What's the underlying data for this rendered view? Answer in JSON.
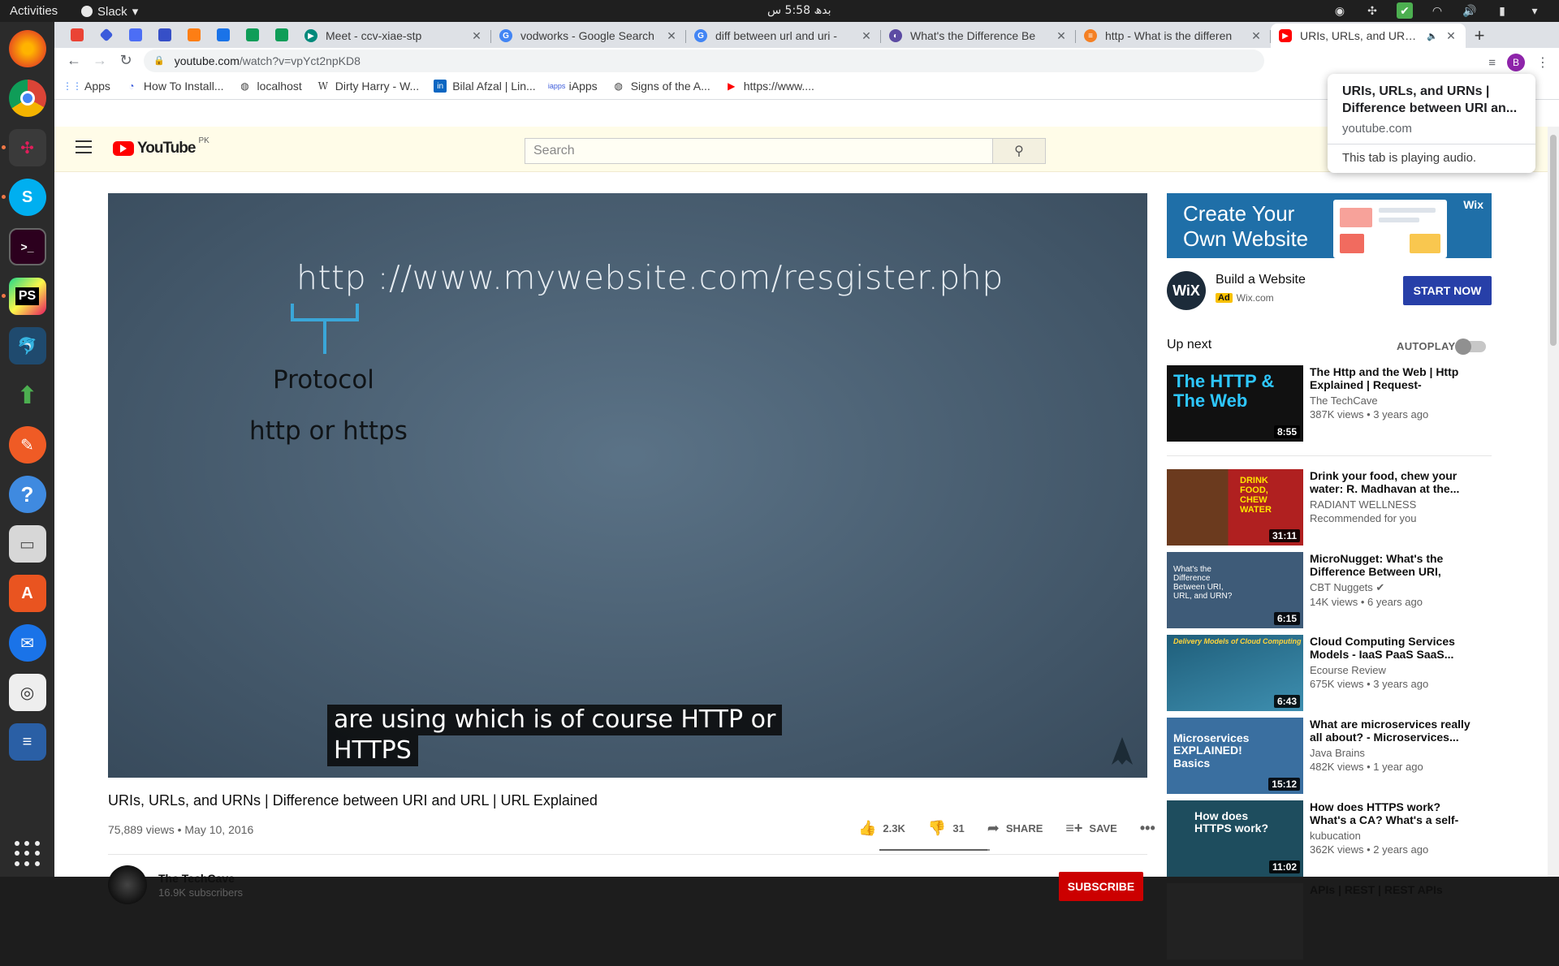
{
  "topbar": {
    "activities": "Activities",
    "app_name": "Slack",
    "clock": "بدھ 5:58 س"
  },
  "tabs": [
    {
      "label": "Meet - ccv-xiae-stp",
      "favicon_color": "#00897b"
    },
    {
      "label": "vodworks - Google Search",
      "favicon_color": "#4285f4"
    },
    {
      "label": "diff between url and uri - ",
      "favicon_color": "#4285f4"
    },
    {
      "label": "What's the Difference Be",
      "favicon_color": "#5c4ba3"
    },
    {
      "label": "http - What is the differen",
      "favicon_color": "#f48024"
    },
    {
      "label": "URIs, URLs, and URNs |",
      "favicon_color": "#ff0000",
      "active": true
    }
  ],
  "omnibox": {
    "host": "youtube.com",
    "path": "/watch?v=vpYct2npKD8"
  },
  "bookmarks": [
    {
      "label": "Apps"
    },
    {
      "label": "How To Install..."
    },
    {
      "label": "localhost"
    },
    {
      "label": "Dirty Harry - W..."
    },
    {
      "label": "Bilal Afzal | Lin..."
    },
    {
      "label": "iApps"
    },
    {
      "label": "Signs of the A..."
    },
    {
      "label": "https://www...."
    }
  ],
  "hovercard": {
    "title": "URIs, URLs, and URNs | Difference between URI an...",
    "url": "youtube.com",
    "note": "This tab is playing audio."
  },
  "youtube": {
    "logo_text": "YouTube",
    "region": "PK",
    "search_placeholder": "Search",
    "avatar_letter": "B"
  },
  "video": {
    "board_url": "http ://www.mywebsite.com/resgister.php",
    "board_protocol": "Protocol",
    "board_protocol_sub": "http or https",
    "caption_line1": "are using which is of course HTTP or",
    "caption_line2": "HTTPS",
    "title": "URIs, URLs, and URNs | Difference between URI and URL | URL Explained",
    "meta": "75,889 views • May 10, 2016",
    "likes": "2.3K",
    "dislikes": "31",
    "share_label": "SHARE",
    "save_label": "SAVE",
    "like_ratio": 0.98
  },
  "channel": {
    "name": "The TechCave",
    "subs": "16.9K subscribers",
    "subscribe_label": "SUBSCRIBE"
  },
  "ad": {
    "banner_line1": "Create Your",
    "banner_line2": "Own Website",
    "banner_brand": "Wix",
    "logo_text": "WiX",
    "title": "Build a Website",
    "badge": "Ad",
    "domain": "Wix.com",
    "cta": "START NOW"
  },
  "upnext": {
    "label": "Up next",
    "autoplay_label": "AUTOPLAY"
  },
  "recs": [
    {
      "title": "The Http and the Web | Http Explained | Request-Response...",
      "channel": "The TechCave",
      "meta": "387K views • 3 years ago",
      "duration": "8:55",
      "thumb_text": "The HTTP & The Web",
      "thumb_color": "#111"
    },
    {
      "title": "Drink your food, chew your water: R. Madhavan at the...",
      "channel": "RADIANT WELLNESS",
      "meta": "Recommended for you",
      "duration": "31:11",
      "thumb_text": "DRINK FOOD, CHEW WATER",
      "thumb_color": "#5a2a12"
    },
    {
      "title": "MicroNugget: What's the Difference Between URI, URL,...",
      "channel": "CBT Nuggets",
      "meta": "14K views • 6 years ago",
      "duration": "6:15",
      "thumb_text": "What's the Difference Between URI, URL, and URN?",
      "thumb_color": "#3e5b78"
    },
    {
      "title": "Cloud Computing Services Models - IaaS PaaS SaaS...",
      "channel": "Ecourse Review",
      "meta": "675K views • 3 years ago",
      "duration": "6:43",
      "thumb_text": "Delivery Models of Cloud Computing",
      "thumb_color": "#2f6d8a"
    },
    {
      "title": "What are microservices really all about? - Microservices...",
      "channel": "Java Brains",
      "meta": "482K views • 1 year ago",
      "duration": "15:12",
      "thumb_text": "Microservices EXPLAINED! Basics",
      "thumb_color": "#3a6fa0"
    },
    {
      "title": "How does HTTPS work? What's a CA? What's a self-signed...",
      "channel": "kubucation",
      "meta": "362K views • 2 years ago",
      "duration": "11:02",
      "thumb_text": "How does HTTPS work?",
      "thumb_color": "#1e4d5e"
    },
    {
      "title": "APIs | REST | REST APIs",
      "channel": "",
      "meta": "",
      "duration": "",
      "thumb_text": "",
      "thumb_color": "#222"
    }
  ]
}
